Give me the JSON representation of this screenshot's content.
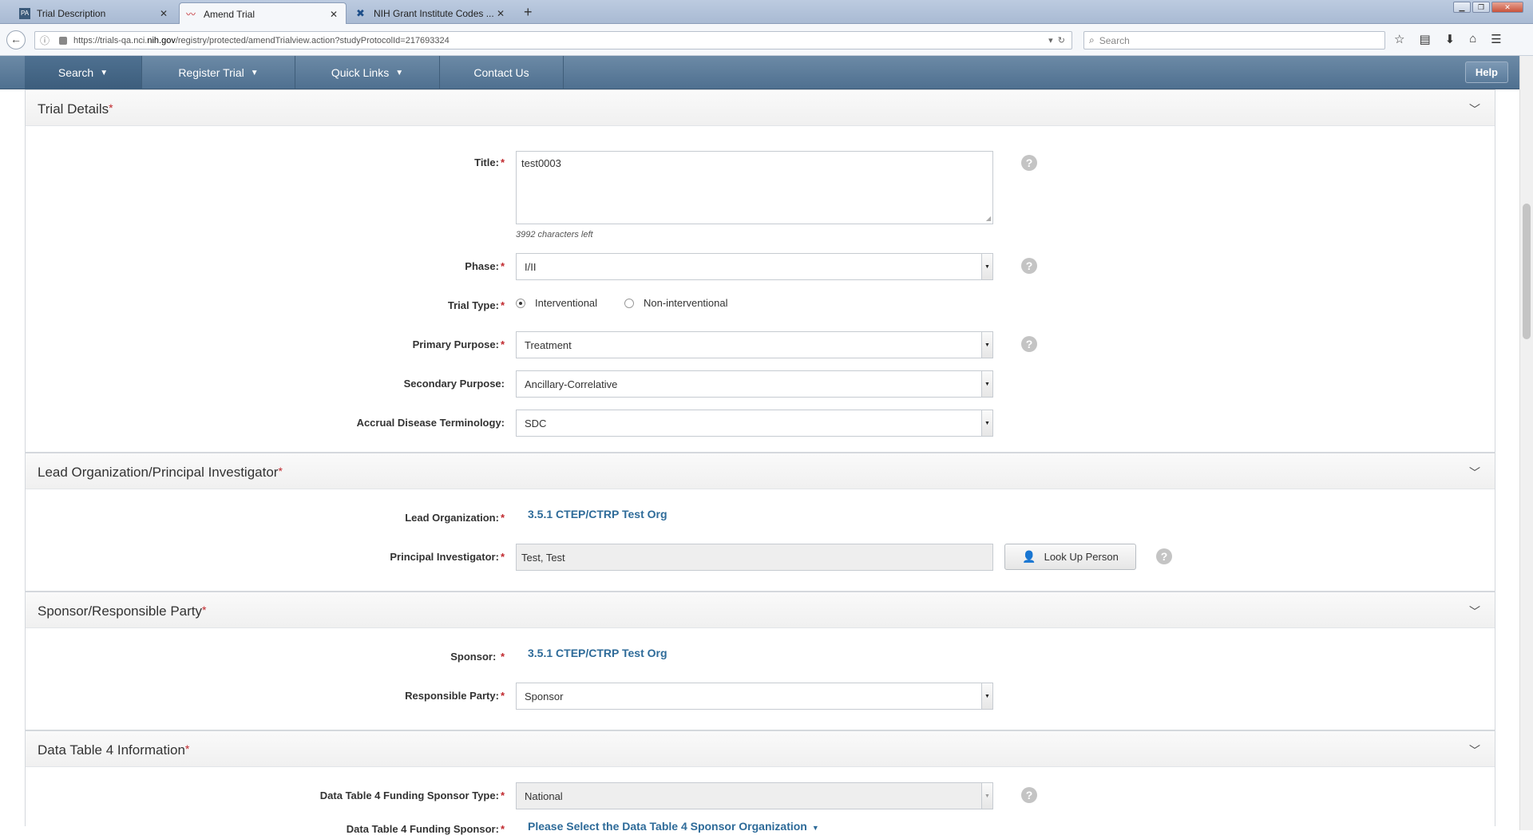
{
  "browser": {
    "tabs": [
      {
        "label": "Trial Description",
        "icon": "pa-favicon"
      },
      {
        "label": "Amend Trial",
        "icon": "chart-favicon"
      },
      {
        "label": "NIH Grant Institute Codes ...",
        "icon": "nih-favicon"
      }
    ],
    "url_prefix": "https://trials-qa.nci.",
    "url_host": "nih.gov",
    "url_path": "/registry/protected/amendTrialview.action?studyProtocolId=217693324",
    "search_placeholder": "Search"
  },
  "menu": {
    "items": [
      {
        "label": "Search",
        "has_caret": true
      },
      {
        "label": "Register Trial",
        "has_caret": true
      },
      {
        "label": "Quick Links",
        "has_caret": true
      },
      {
        "label": "Contact Us",
        "has_caret": false
      }
    ],
    "help_label": "Help"
  },
  "sections": {
    "trial_details": {
      "title": "Trial Details",
      "title_label": "Title:",
      "title_value": "test0003",
      "chars_left": "3992 characters left",
      "phase_label": "Phase:",
      "phase_value": "I/II",
      "trial_type_label": "Trial Type:",
      "trial_type_options": [
        "Interventional",
        "Non-interventional"
      ],
      "trial_type_selected": "Interventional",
      "primary_purpose_label": "Primary Purpose:",
      "primary_purpose_value": "Treatment",
      "secondary_purpose_label": "Secondary Purpose:",
      "secondary_purpose_value": "Ancillary-Correlative",
      "accrual_label": "Accrual Disease Terminology:",
      "accrual_value": "SDC"
    },
    "lead_org": {
      "title": "Lead Organization/Principal Investigator",
      "lead_org_label": "Lead Organization:",
      "lead_org_value": "3.5.1 CTEP/CTRP Test Org",
      "pi_label": "Principal Investigator:",
      "pi_value": "Test, Test",
      "lookup_label": "Look Up Person"
    },
    "sponsor": {
      "title": "Sponsor/Responsible Party",
      "sponsor_label": "Sponsor:",
      "sponsor_value": "3.5.1 CTEP/CTRP Test Org",
      "responsible_label": "Responsible Party:",
      "responsible_value": "Sponsor"
    },
    "data_table4": {
      "title": "Data Table 4 Information",
      "funding_type_label": "Data Table 4 Funding Sponsor Type:",
      "funding_type_value": "National",
      "funding_sponsor_label": "Data Table 4 Funding Sponsor:",
      "funding_sponsor_link": "Please Select the Data Table 4 Sponsor Organization"
    }
  },
  "colors": {
    "menu_bg": "#5a7b9b",
    "link": "#2e6b99",
    "required": "#c0282d"
  }
}
